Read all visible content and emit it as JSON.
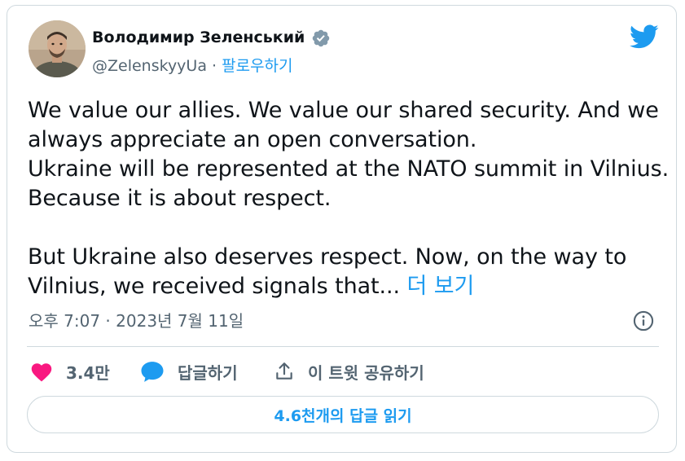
{
  "author": {
    "display_name": "Володимир Зеленський",
    "handle": "@ZelenskyyUa",
    "separator": " · ",
    "follow_label": "팔로우하기",
    "verified": true
  },
  "tweet": {
    "text": "We value our allies. We value our shared security. And we\nalways appreciate an open conversation.\nUkraine will be represented at the NATO summit in Vilnius.\nBecause it is about respect.\n\nBut Ukraine also deserves respect. Now, on the way to\nVilnius, we received signals that... ",
    "show_more_label": "더 보기",
    "timestamp": "오후 7:07 · 2023년 7월 11일"
  },
  "actions": {
    "like_count": "3.4만",
    "reply_label": "답글하기",
    "share_label": "이 트윗 공유하기"
  },
  "replies_button": {
    "label": "4.6천개의 답글 읽기"
  },
  "icons": {
    "platform": "twitter-bird-icon",
    "verified": "verified-badge-icon",
    "info": "info-icon",
    "like": "heart-icon",
    "reply": "speech-bubble-icon",
    "share": "share-upload-icon"
  },
  "colors": {
    "accent": "#1d9bf0",
    "like": "#f91880",
    "text": "#0f1419",
    "secondary_text": "#536471",
    "border": "#cfd9de"
  }
}
